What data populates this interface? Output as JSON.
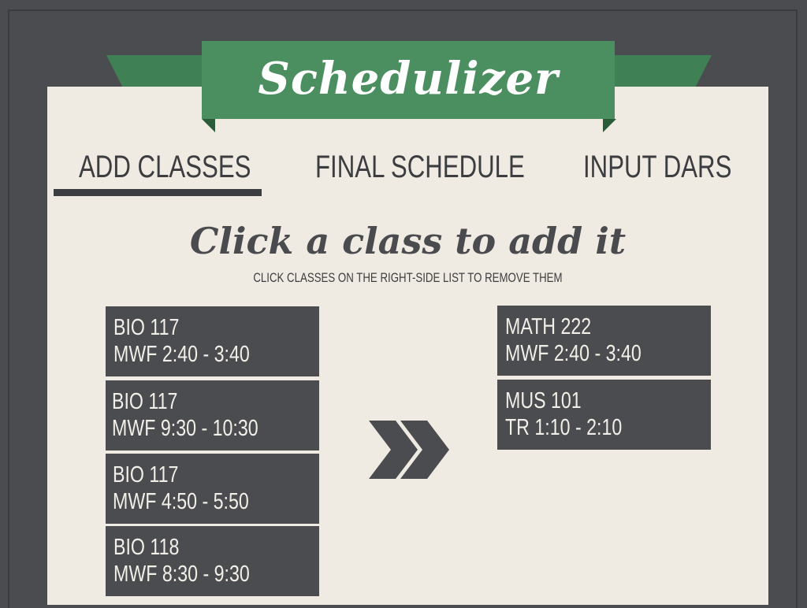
{
  "app": {
    "title": "Schedulizer"
  },
  "tabs": [
    {
      "label": "ADD CLASSES",
      "active": true
    },
    {
      "label": "FINAL SCHEDULE",
      "active": false
    },
    {
      "label": "INPUT DARS",
      "active": false
    }
  ],
  "instructions": {
    "heading": "Click a class to add it",
    "subheading": "CLICK CLASSES ON THE RIGHT-SIDE LIST  TO REMOVE THEM"
  },
  "available_classes": [
    {
      "course": "BIO 117",
      "time": "MWF 2:40 - 3:40"
    },
    {
      "course": "BIO 117",
      "time": "MWF 9:30 - 10:30"
    },
    {
      "course": "BIO 117",
      "time": "MWF 4:50 - 5:50"
    },
    {
      "course": "BIO 118",
      "time": "MWF 8:30 - 9:30"
    }
  ],
  "selected_classes": [
    {
      "course": "MATH 222",
      "time": "MWF 2:40 - 3:40"
    },
    {
      "course": "MUS 101",
      "time": "TR 1:10 - 2:10"
    }
  ],
  "icons": {
    "transfer": "double-chevron-right-icon"
  },
  "colors": {
    "background": "#4b4c4f",
    "paper": "#efebe2",
    "ribbon": "#4b8e5f",
    "card": "#4b4c4f",
    "text_dark": "#3c3d40"
  }
}
